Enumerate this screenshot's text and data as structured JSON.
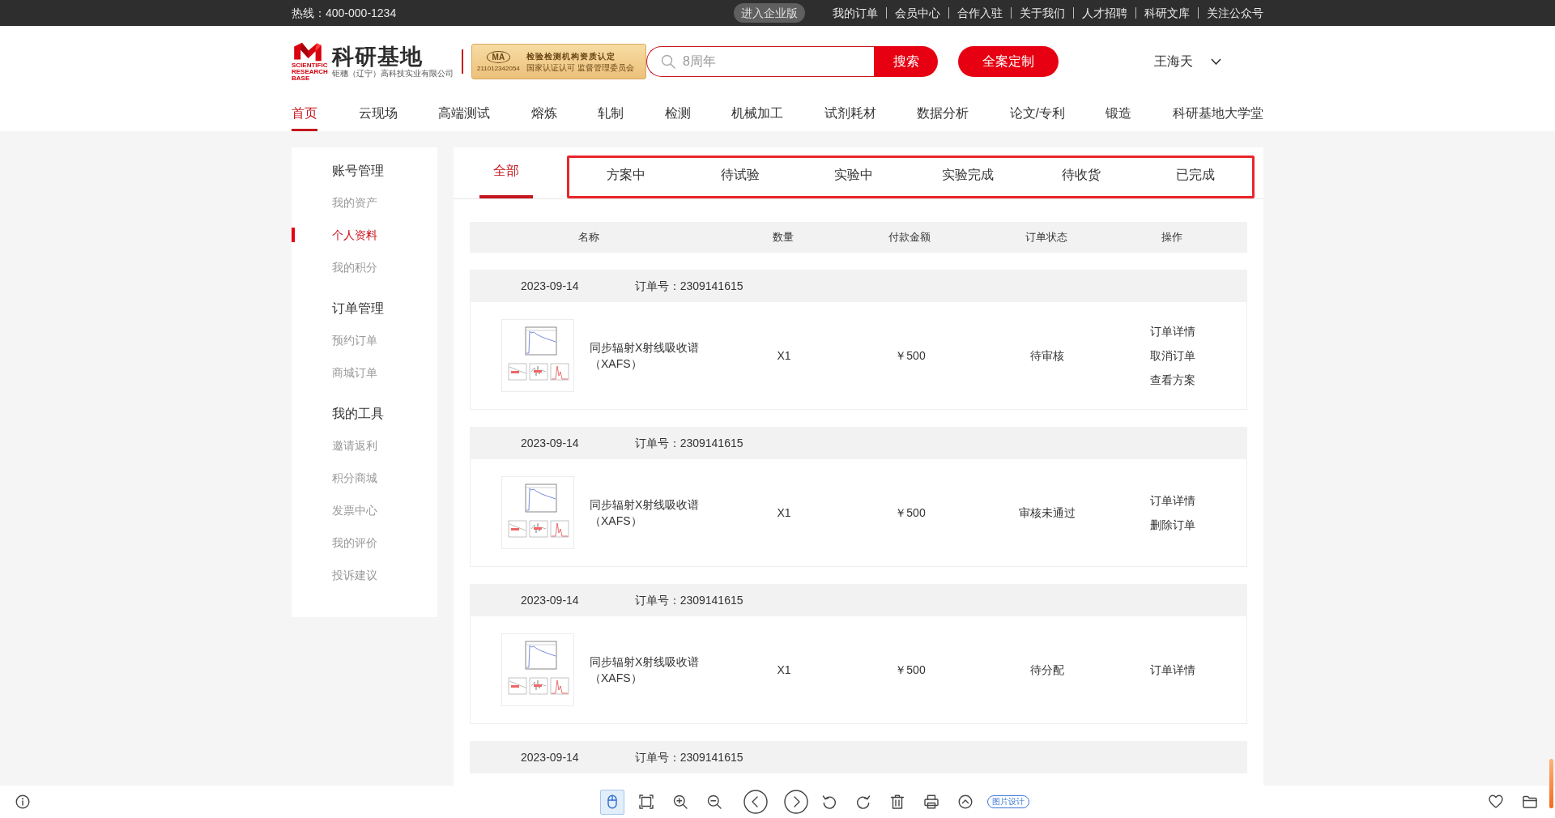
{
  "top_bar": {
    "hotline": "热线：400-000-1234",
    "enterprise_button": "进入企业版",
    "links": [
      "我的订单",
      "会员中心",
      "合作入驻",
      "关于我们",
      "人才招聘",
      "科研文库",
      "关注公众号"
    ]
  },
  "header": {
    "logo": {
      "title": "科研基地",
      "english": "SCIENTIFIC RESEARCH BASE",
      "company": "钜穗（辽宁）高科技实业有限公司"
    },
    "certificate": {
      "mark": "MA",
      "number": "211012342054",
      "title": "检验检测机构资质认定",
      "subtitle": "国家认证认可 监督管理委员会"
    },
    "search": {
      "placeholder": "8周年",
      "button": "搜索"
    },
    "custom_button": "全案定制",
    "user": "王海天"
  },
  "nav": [
    {
      "label": "首页",
      "selected": true
    },
    {
      "label": "云现场",
      "selected": false
    },
    {
      "label": "高端测试",
      "selected": false
    },
    {
      "label": "熔炼",
      "selected": false
    },
    {
      "label": "轧制",
      "selected": false
    },
    {
      "label": "检测",
      "selected": false
    },
    {
      "label": "机械加工",
      "selected": false
    },
    {
      "label": "试剂耗材",
      "selected": false
    },
    {
      "label": "数据分析",
      "selected": false
    },
    {
      "label": "论文/专利",
      "selected": false
    },
    {
      "label": "锻造",
      "selected": false
    },
    {
      "label": "科研基地大学堂",
      "selected": false
    }
  ],
  "sidebar": [
    {
      "title": "账号管理",
      "items": [
        {
          "label": "我的资产",
          "selected": false
        },
        {
          "label": "个人资料",
          "selected": true
        },
        {
          "label": "我的积分",
          "selected": false
        }
      ]
    },
    {
      "title": "订单管理",
      "items": [
        {
          "label": "预约订单",
          "selected": false
        },
        {
          "label": "商城订单",
          "selected": false
        }
      ]
    },
    {
      "title": "我的工具",
      "items": [
        {
          "label": "邀请返利",
          "selected": false
        },
        {
          "label": "积分商城",
          "selected": false
        },
        {
          "label": "发票中心",
          "selected": false
        },
        {
          "label": "我的评价",
          "selected": false
        },
        {
          "label": "投诉建议",
          "selected": false
        }
      ]
    }
  ],
  "order_tabs": [
    {
      "kind": "tab",
      "label": "全部",
      "selected": true
    },
    {
      "kind": "outline",
      "tabs": [
        {
          "label": "方案中",
          "selected": false
        },
        {
          "label": "待试验",
          "selected": false
        },
        {
          "label": "实验中",
          "selected": false
        },
        {
          "label": "实验完成",
          "selected": false
        },
        {
          "label": "待收货",
          "selected": false
        },
        {
          "label": "已完成",
          "selected": false
        }
      ]
    }
  ],
  "table": {
    "columns": [
      "名称",
      "数量",
      "付款金额",
      "订单状态",
      "操作"
    ]
  },
  "orders": [
    {
      "date": "2023-09-14",
      "order_no": "订单号：2309141615",
      "items": [
        {
          "name": "同步辐射X射线吸收谱（XAFS）",
          "quantity": "X1",
          "price": "￥500",
          "status": "待审核",
          "actions": [
            "订单详情",
            "取消订单",
            "查看方案"
          ]
        }
      ]
    },
    {
      "date": "2023-09-14",
      "order_no": "订单号：2309141615",
      "items": [
        {
          "name": "同步辐射X射线吸收谱（XAFS）",
          "quantity": "X1",
          "price": "￥500",
          "status": "审核未通过",
          "actions": [
            "订单详情",
            "删除订单"
          ]
        }
      ]
    },
    {
      "date": "2023-09-14",
      "order_no": "订单号：2309141615",
      "items": [
        {
          "name": "同步辐射X射线吸收谱（XAFS）",
          "quantity": "X1",
          "price": "￥500",
          "status": "待分配",
          "actions": [
            "订单详情"
          ]
        }
      ]
    },
    {
      "date": "2023-09-14",
      "order_no": "订单号：2309141615"
    }
  ],
  "viewer_toolbar": {
    "left": [
      {
        "kind": "info"
      }
    ],
    "tools": [
      {
        "kind": "pointer",
        "selected": true
      },
      {
        "kind": "fit",
        "selected": false
      },
      {
        "kind": "zoom-in",
        "selected": false
      },
      {
        "kind": "zoom-out",
        "selected": false
      },
      {
        "kind": "prev",
        "selected": false
      },
      {
        "kind": "next",
        "selected": false
      },
      {
        "kind": "rotate-left",
        "selected": false
      },
      {
        "kind": "rotate-right",
        "selected": false
      },
      {
        "kind": "delete",
        "selected": false
      },
      {
        "kind": "print",
        "selected": false
      },
      {
        "kind": "up",
        "selected": false
      },
      {
        "kind": "tag",
        "label": "图片设计",
        "selected": false
      }
    ],
    "right": [
      {
        "kind": "favorite"
      },
      {
        "kind": "folder"
      }
    ]
  }
}
